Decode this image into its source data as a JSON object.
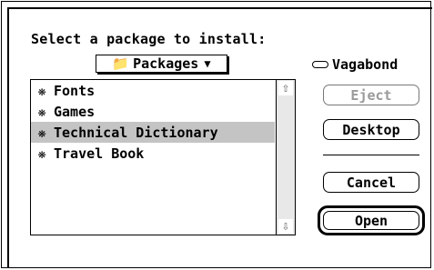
{
  "dialog": {
    "prompt": "Select a package to install:",
    "popup": {
      "label": "Packages",
      "folder_icon": "📁",
      "arrow": "▼"
    },
    "volume": {
      "name": "Vagabond",
      "icon": "disk-icon"
    },
    "file_list": [
      {
        "label": "Fonts",
        "icon": "package-icon",
        "selected": false
      },
      {
        "label": "Games",
        "icon": "package-icon",
        "selected": false
      },
      {
        "label": "Technical Dictionary",
        "icon": "package-icon",
        "selected": true
      },
      {
        "label": "Travel Book",
        "icon": "package-icon",
        "selected": false
      }
    ],
    "scroll": {
      "up_glyph": "⇧",
      "down_glyph": "⇩"
    },
    "buttons": {
      "eject": "Eject",
      "desktop": "Desktop",
      "cancel": "Cancel",
      "open": "Open"
    },
    "colors": {
      "selection": "#c4c4c4",
      "disabled_text": "#9a9a9a"
    }
  }
}
